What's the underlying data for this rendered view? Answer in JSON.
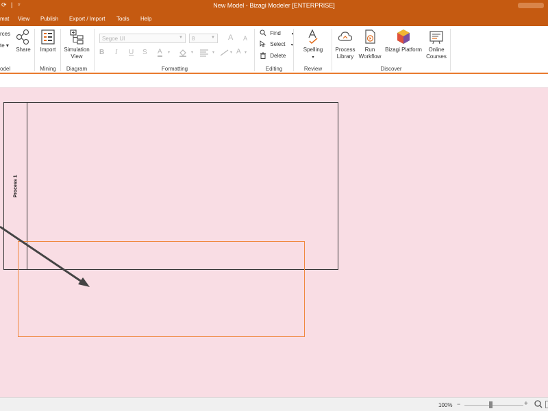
{
  "window": {
    "title": "New Model - Bizagi Modeler [ENTERPRISE]"
  },
  "menu": {
    "items": [
      {
        "label": "mat"
      },
      {
        "label": "View"
      },
      {
        "label": "Publish"
      },
      {
        "label": "Export / Import"
      },
      {
        "label": "Tools"
      },
      {
        "label": "Help"
      }
    ]
  },
  "ribbon": {
    "model": {
      "resources_label": "rces",
      "validate_label": "te",
      "share_label": "Share",
      "group_label": "odel"
    },
    "mining": {
      "import_label": "Import",
      "group_label": "Mining"
    },
    "diagram": {
      "simulation_label_1": "Simulation",
      "simulation_label_2": "View",
      "group_label": "Diagram"
    },
    "formatting": {
      "font_name": "Segoe UI",
      "font_size": "8",
      "group_label": "Formatting",
      "grow_label": "A",
      "shrink_label": "A",
      "bold_label": "B",
      "italic_label": "I",
      "underline_label": "U",
      "strike_label": "S",
      "fontcolor_label": "A",
      "textsize_label": "A"
    },
    "editing": {
      "find_label": "Find",
      "select_label": "Select",
      "delete_label": "Delete",
      "group_label": "Editing"
    },
    "review": {
      "spelling_label": "Spelling",
      "group_label": "Review"
    },
    "discover": {
      "process_library_1": "Process",
      "process_library_2": "Library",
      "run_workflow_1": "Run",
      "run_workflow_2": "Workflow",
      "bizagi_platform": "Bizagi Platform",
      "online_courses_1": "Online",
      "online_courses_2": "Courses",
      "group_label": "Discover"
    }
  },
  "canvas": {
    "pool_title": "Process 1"
  },
  "statusbar": {
    "zoom": "100%",
    "zoom_level": 1.0,
    "minus": "−",
    "plus": "+"
  },
  "colors": {
    "accent": "#c55a11",
    "canvas_bg": "#f9dde4",
    "selection": "#f0883e"
  }
}
